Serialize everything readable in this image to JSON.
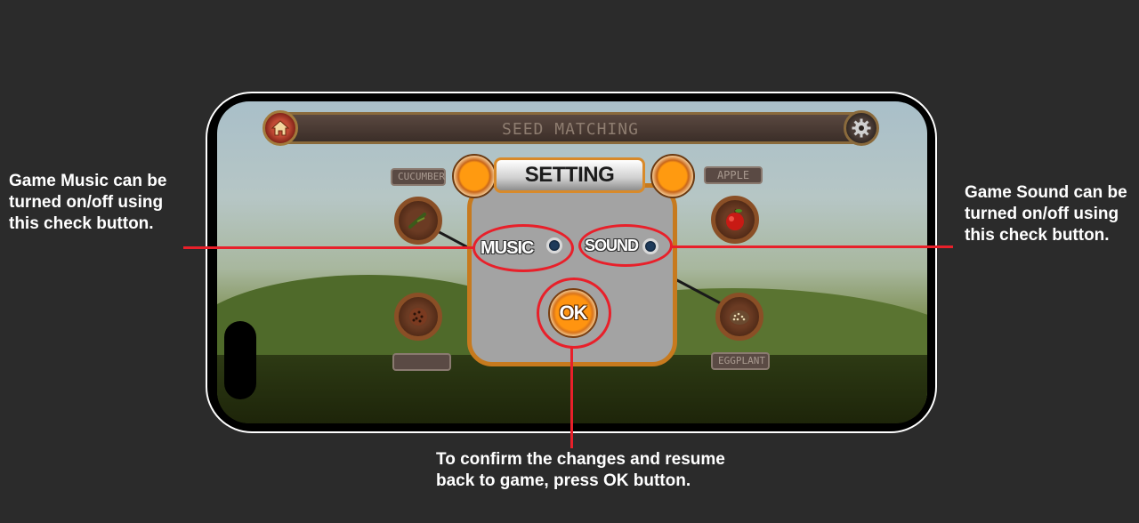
{
  "game": {
    "title": "SEED MATCHING",
    "home_icon": "home-icon",
    "settings_icon": "gear-icon",
    "seeds": {
      "left_top_label": "CUCUMBER",
      "right_top_label": "APPLE",
      "right_bottom_label": "EGGPLANT",
      "left_bottom_label": ""
    }
  },
  "setting_dialog": {
    "title": "SETTING",
    "music_label": "MUSIC",
    "sound_label": "SOUND",
    "ok_label": "OK"
  },
  "annotations": {
    "music": "Game Music can be turned on/off using this check button.",
    "sound": "Game Sound can be turned on/off using this check button.",
    "ok": "To confirm the changes and resume back to game, press OK button."
  },
  "colors": {
    "highlight": "#e8202a",
    "panel_border": "#c77a1e",
    "orb": "#ff9a10"
  }
}
